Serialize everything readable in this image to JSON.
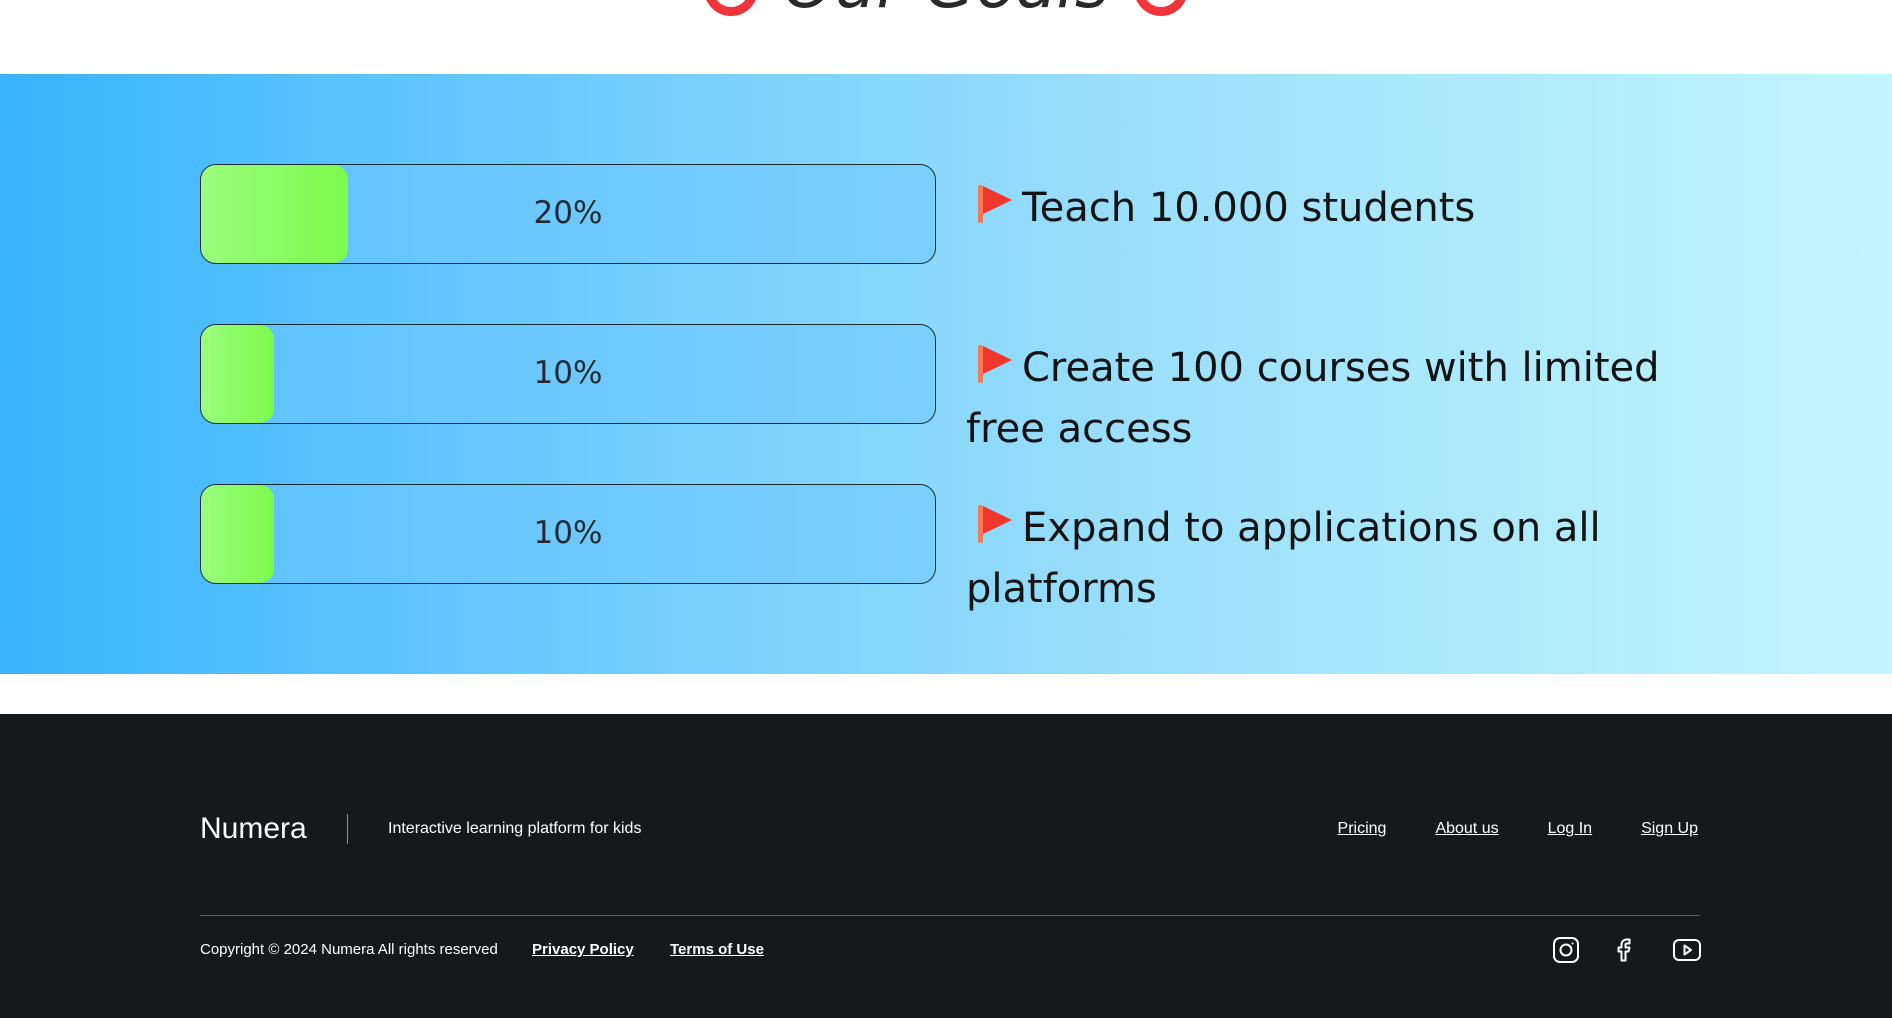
{
  "heading": {
    "title": "Our Goals",
    "icon_left": "target-icon",
    "icon_right": "target-icon"
  },
  "goals": [
    {
      "percent_label": "20%",
      "progress": 0.2,
      "icon": "flag-icon",
      "text": "Teach 10.000 students"
    },
    {
      "percent_label": "10%",
      "progress": 0.1,
      "icon": "flag-icon",
      "text": "Create 100 courses with limited free access"
    },
    {
      "percent_label": "10%",
      "progress": 0.1,
      "icon": "flag-icon",
      "text": "Expand to applications on all platforms"
    }
  ],
  "footer": {
    "brand": "Numera",
    "tagline": "Interactive learning platform for kids",
    "nav": [
      "Pricing",
      "About us",
      "Log In",
      "Sign Up"
    ],
    "copyright": "Copyright © 2024 Numera All rights reserved",
    "privacy": "Privacy Policy",
    "terms": "Terms of Use",
    "socials": [
      "instagram-icon",
      "facebook-icon",
      "youtube-icon"
    ]
  },
  "colors": {
    "band_start": "#38b4fd",
    "band_end": "#c3f6fd",
    "progress_fill": "#7cfa4c",
    "flag": "#f2372d",
    "target": "#f0343a",
    "footer_bg": "#15191b"
  }
}
